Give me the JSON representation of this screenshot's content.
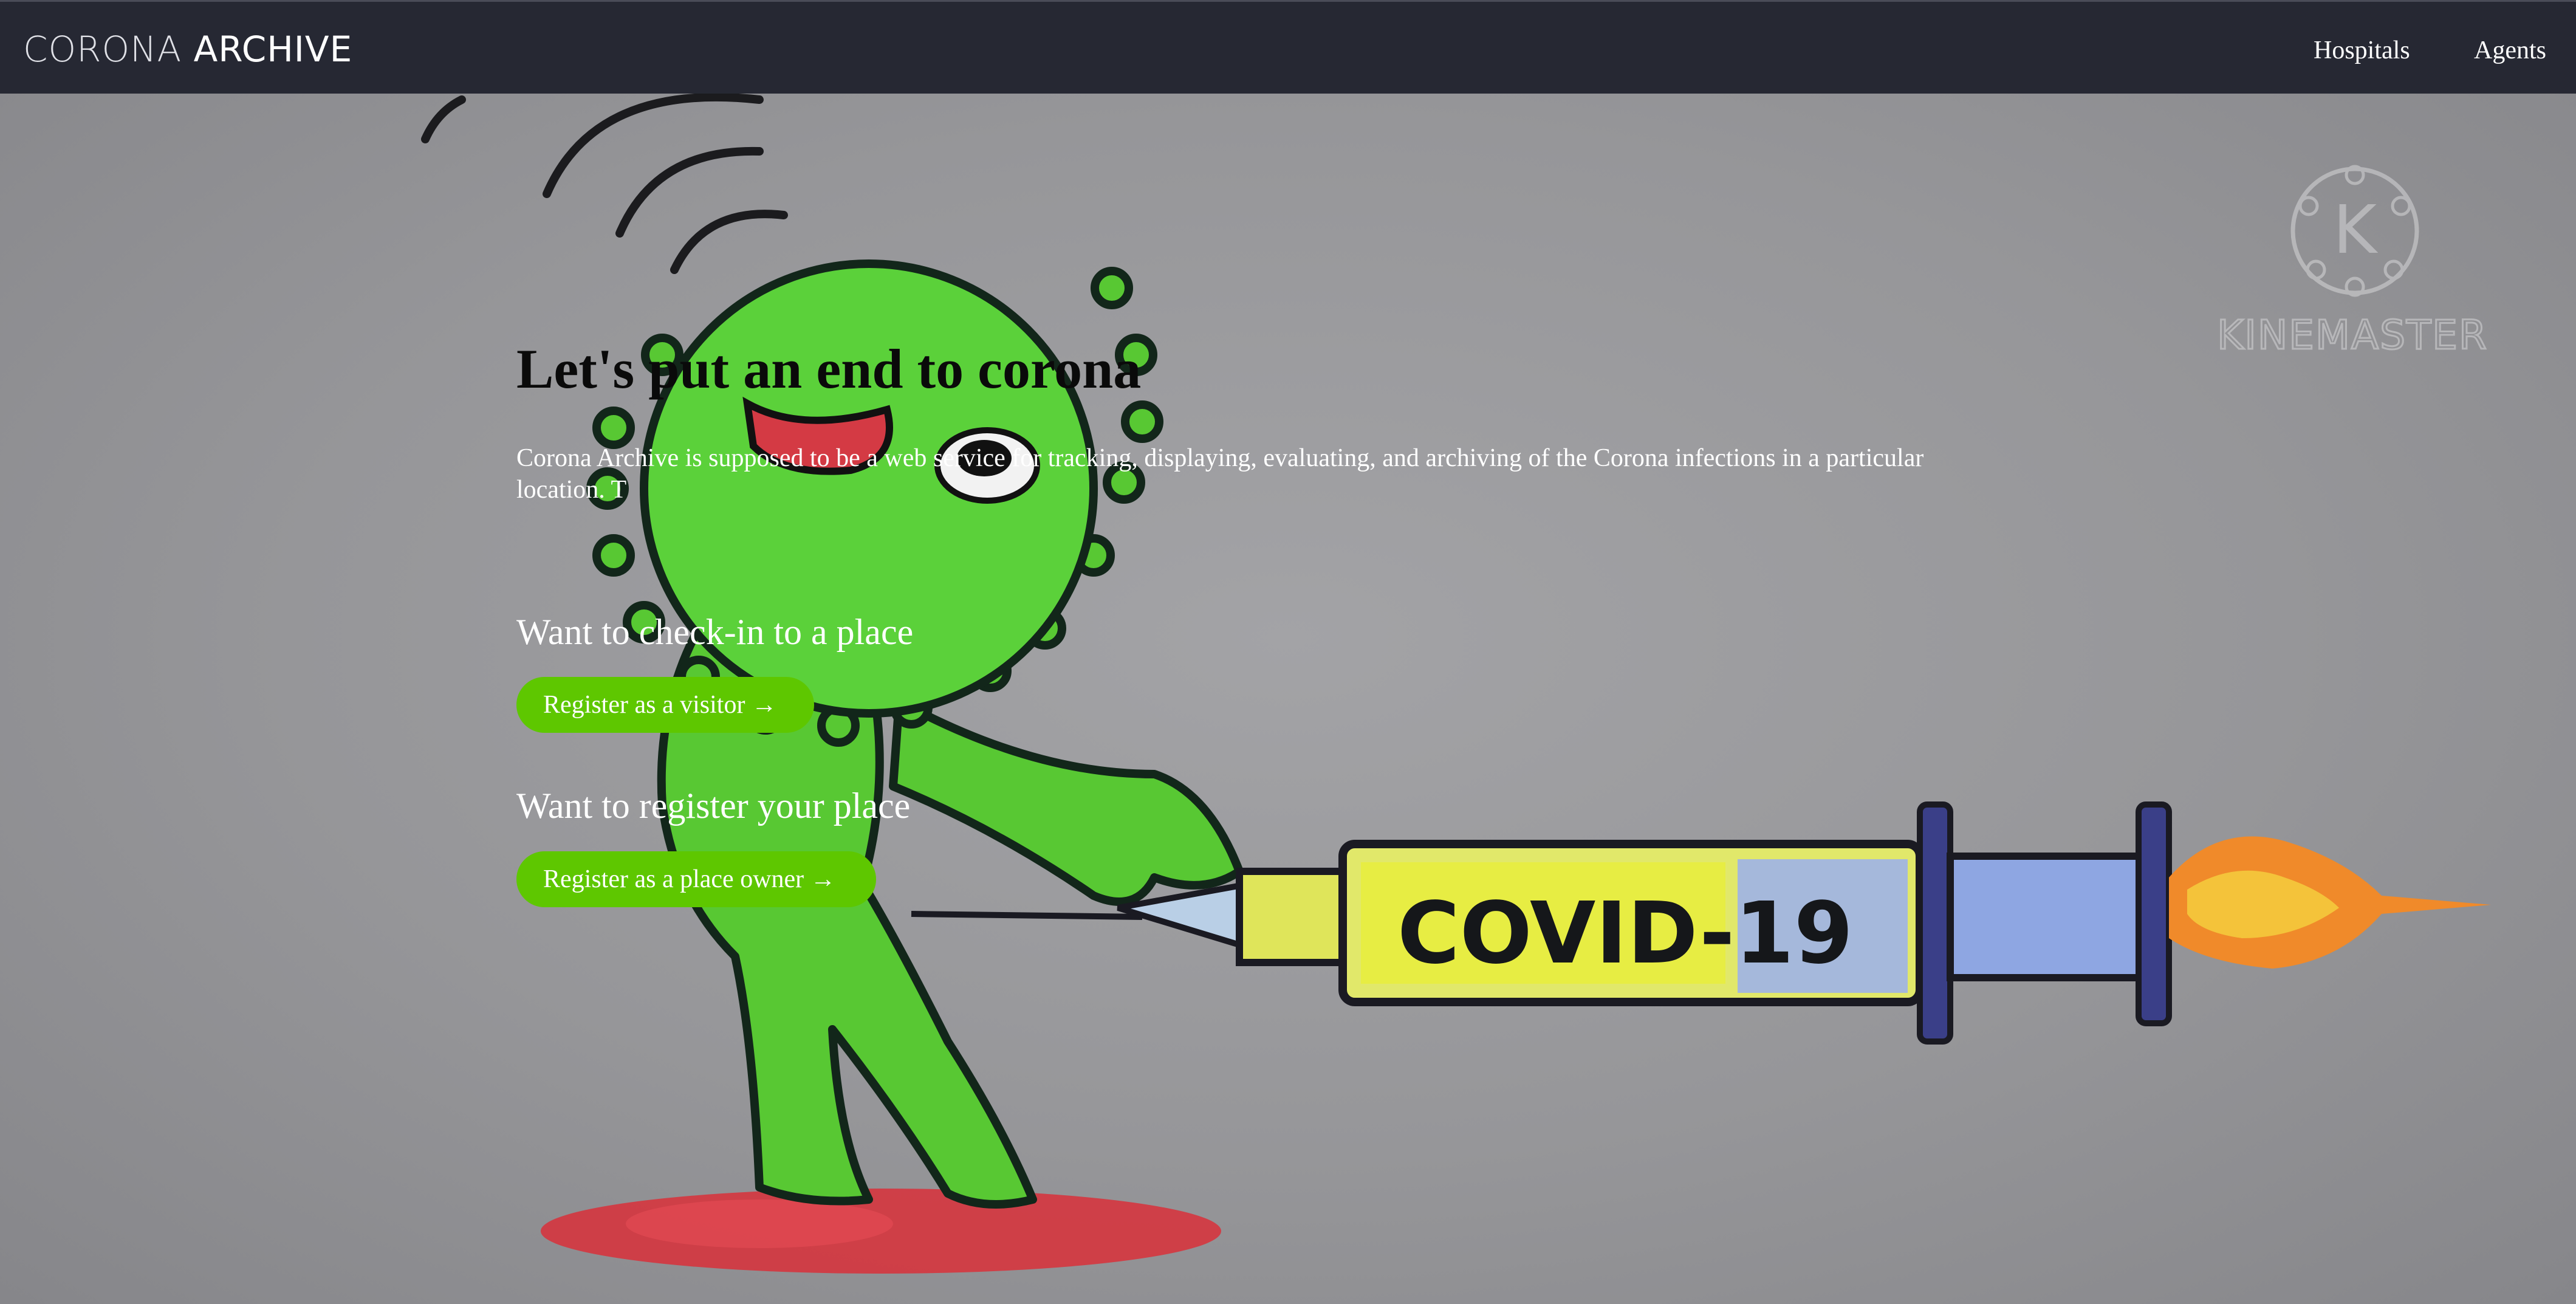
{
  "navbar": {
    "logo_light": "CORONA",
    "logo_bold": "ARCHIVE",
    "links": [
      "Hospitals",
      "Agents"
    ]
  },
  "hero": {
    "headline": "Let's put an end to corona",
    "intro": "Corona Archive is supposed to be a web service for tracking, displaying, evaluating, and archiving of the Corona infections in a particular location. T",
    "visitor_section": {
      "title": "Want to check-in to a place",
      "button": "Register as a visitor →"
    },
    "owner_section": {
      "title": "Want to register your place",
      "button": "Register as a place owner →"
    }
  },
  "background_art": {
    "syringe_label": "COVID-19",
    "watermark": "KINEMASTER",
    "watermark_letter": "K"
  },
  "colors": {
    "navbar": "#262833",
    "button": "#5ec700",
    "virus": "#5bd13a",
    "background": "#9a9a9c"
  }
}
